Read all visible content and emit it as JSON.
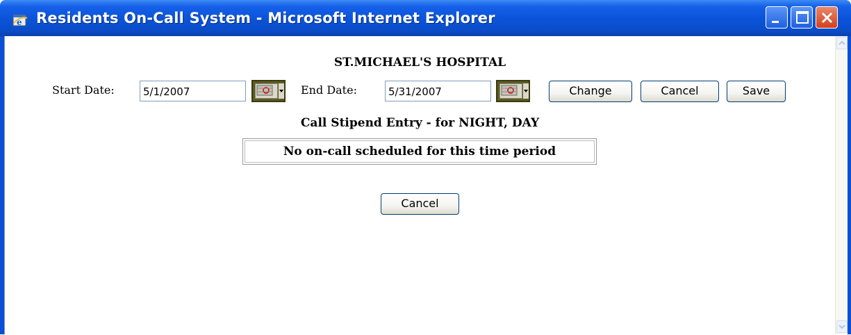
{
  "window": {
    "title": "Residents On-Call System - Microsoft Internet Explorer"
  },
  "page": {
    "hospital_name": "ST.MICHAEL'S HOSPITAL",
    "start_date_label": "Start Date:",
    "start_date_value": "5/1/2007",
    "end_date_label": "End Date:",
    "end_date_value": "5/31/2007",
    "change_label": "Change",
    "cancel_label": "Cancel",
    "save_label": "Save",
    "entry_title": "Call Stipend Entry - for NIGHT, DAY",
    "message": "No on-call scheduled for this time period",
    "bottom_cancel_label": "Cancel"
  },
  "colors": {
    "titlebar": "#0a53d8",
    "close_button": "#d2401e",
    "button_border": "#003c74"
  },
  "icons": [
    "ie-icon",
    "minimize-icon",
    "maximize-icon",
    "close-icon",
    "calendar-icon",
    "scroll-up-arrow-icon",
    "scroll-down-arrow-icon"
  ]
}
